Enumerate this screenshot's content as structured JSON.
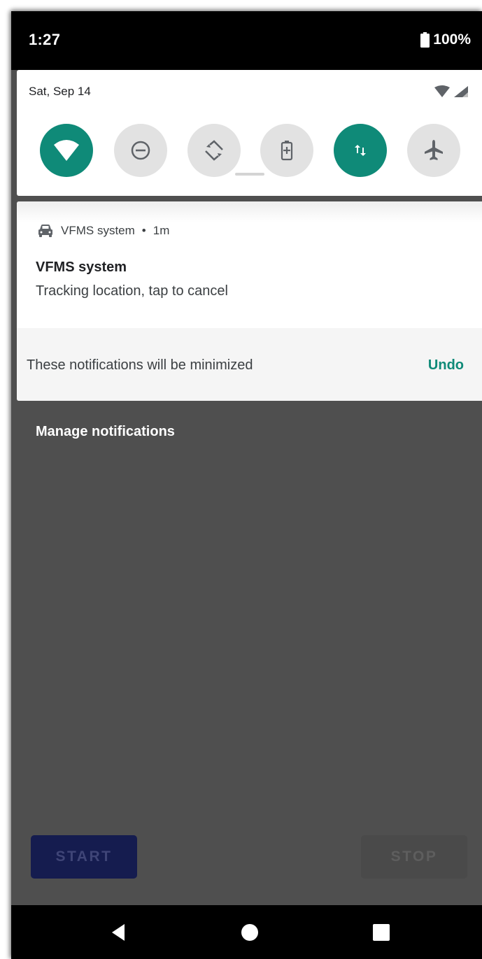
{
  "status_bar": {
    "time": "1:27",
    "battery": "100%"
  },
  "quick_settings": {
    "date": "Sat, Sep 14",
    "tiles": [
      {
        "icon": "wifi-icon",
        "active": true
      },
      {
        "icon": "do-not-disturb-icon",
        "active": false
      },
      {
        "icon": "auto-rotate-icon",
        "active": false
      },
      {
        "icon": "battery-saver-icon",
        "active": false
      },
      {
        "icon": "mobile-data-icon",
        "active": true
      },
      {
        "icon": "airplane-mode-icon",
        "active": false
      }
    ],
    "accent_color": "#0f8a78"
  },
  "notification": {
    "app_icon": "car-icon",
    "app_name": "VFMS system",
    "separator": "•",
    "time_ago": "1m",
    "title": "VFMS system",
    "body": "Tracking location, tap to cancel",
    "minimize_message": "These notifications will be minimized",
    "undo_label": "Undo"
  },
  "manage_notifications_label": "Manage notifications",
  "app": {
    "start_label": "START",
    "stop_label": "STOP"
  },
  "nav": {
    "back_icon": "back-icon",
    "home_icon": "home-icon",
    "recents_icon": "recents-icon"
  }
}
